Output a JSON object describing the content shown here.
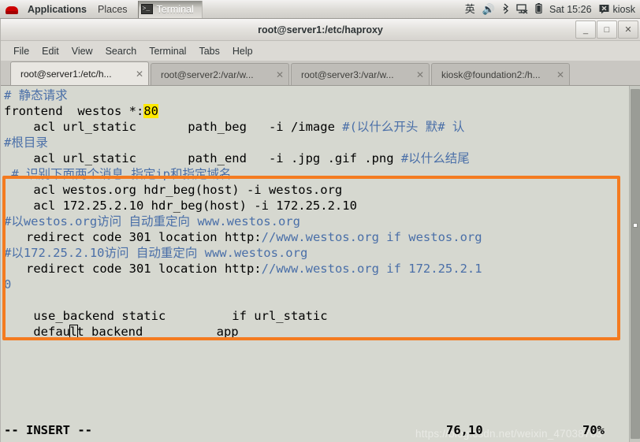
{
  "panel": {
    "logo_icon": "redhat-logo-icon",
    "applications_label": "Applications",
    "places_label": "Places",
    "window_button_label": "Terminal",
    "window_button_icon": "terminal-icon",
    "tray": {
      "ime_label": "英",
      "volume_icon": "speaker-icon",
      "bluetooth_icon": "bluetooth-icon",
      "network_icon": "network-disconnected-icon",
      "battery_icon": "battery-icon",
      "clock": "Sat 15:26",
      "user_icon": "user-icon",
      "user_label": "kiosk"
    }
  },
  "window": {
    "title": "root@server1:/etc/haproxy",
    "buttons": {
      "minimize": "_",
      "maximize": "□",
      "close": "✕"
    },
    "menus": [
      "File",
      "Edit",
      "View",
      "Search",
      "Terminal",
      "Tabs",
      "Help"
    ],
    "tabs": [
      {
        "label": "root@server1:/etc/h...",
        "close": "✕",
        "active": true
      },
      {
        "label": "root@server2:/var/w...",
        "close": "✕",
        "active": false
      },
      {
        "label": "root@server3:/var/w...",
        "close": "✕",
        "active": false
      },
      {
        "label": "kiosk@foundation2:/h...",
        "close": "✕",
        "active": false
      }
    ]
  },
  "terminal": {
    "colors": {
      "background": "#d6d8d0",
      "foreground": "#000000",
      "comment": "#4a6fa8",
      "search_highlight": "#ffe800",
      "annotation_box": "#f47b20"
    },
    "lines": [
      {
        "segments": [
          {
            "t": "# 静态请求",
            "c": "cmt"
          }
        ]
      },
      {
        "segments": [
          {
            "t": "frontend  westos *:",
            "c": ""
          },
          {
            "t": "80",
            "c": "hl"
          }
        ]
      },
      {
        "segments": [
          {
            "t": "    acl url_static       path_beg   -i /image ",
            "c": ""
          },
          {
            "t": "#(以什么开头 默# 认",
            "c": "cmt"
          }
        ]
      },
      {
        "segments": [
          {
            "t": "#根目录",
            "c": "cmt"
          }
        ]
      },
      {
        "segments": [
          {
            "t": "    acl url_static       path_end   -i .jpg .gif .png ",
            "c": ""
          },
          {
            "t": "#以什么结尾",
            "c": "cmt"
          }
        ]
      },
      {
        "segments": [
          {
            "t": " # 识别下面两个消息 指定ip和指定域名",
            "c": "cmt"
          }
        ]
      },
      {
        "segments": [
          {
            "t": "    acl westos.org hdr_beg(host) -i westos.org",
            "c": ""
          }
        ]
      },
      {
        "segments": [
          {
            "t": "    acl 172.25.2.10 hdr_beg(host) -i 172.25.2.10",
            "c": ""
          }
        ]
      },
      {
        "segments": [
          {
            "t": "#以westos.org访问 自动重定向 www.westos.org",
            "c": "cmt"
          }
        ]
      },
      {
        "segments": [
          {
            "t": "   redirect code 301 location http:",
            "c": ""
          },
          {
            "t": "//www.westos.org if westos.org",
            "c": "cmt"
          }
        ]
      },
      {
        "segments": [
          {
            "t": "#以172.25.2.10访问 自动重定向 www.westos.org",
            "c": "cmt"
          }
        ]
      },
      {
        "segments": [
          {
            "t": "   redirect code 301 location http:",
            "c": ""
          },
          {
            "t": "//www.westos.org if 172.25.2.1",
            "c": "cmt"
          }
        ]
      },
      {
        "segments": [
          {
            "t": "0",
            "c": "cmt"
          }
        ]
      },
      {
        "segments": [
          {
            "t": "",
            "c": ""
          }
        ]
      },
      {
        "segments": [
          {
            "t": "    use_backend static         if url_static",
            "c": ""
          }
        ]
      },
      {
        "segments": [
          {
            "t": "    defau",
            "c": ""
          },
          {
            "t": "l",
            "c": "cur"
          },
          {
            "t": "t_backend          app",
            "c": ""
          }
        ]
      },
      {
        "segments": [
          {
            "t": "",
            "c": ""
          }
        ]
      }
    ],
    "status": {
      "mode": "-- INSERT --",
      "position": "76,10",
      "percent": "70%"
    },
    "watermark": "https://blog.csdn.net/weixin_47038763",
    "scrollbar_name": "vertical-scrollbar"
  }
}
